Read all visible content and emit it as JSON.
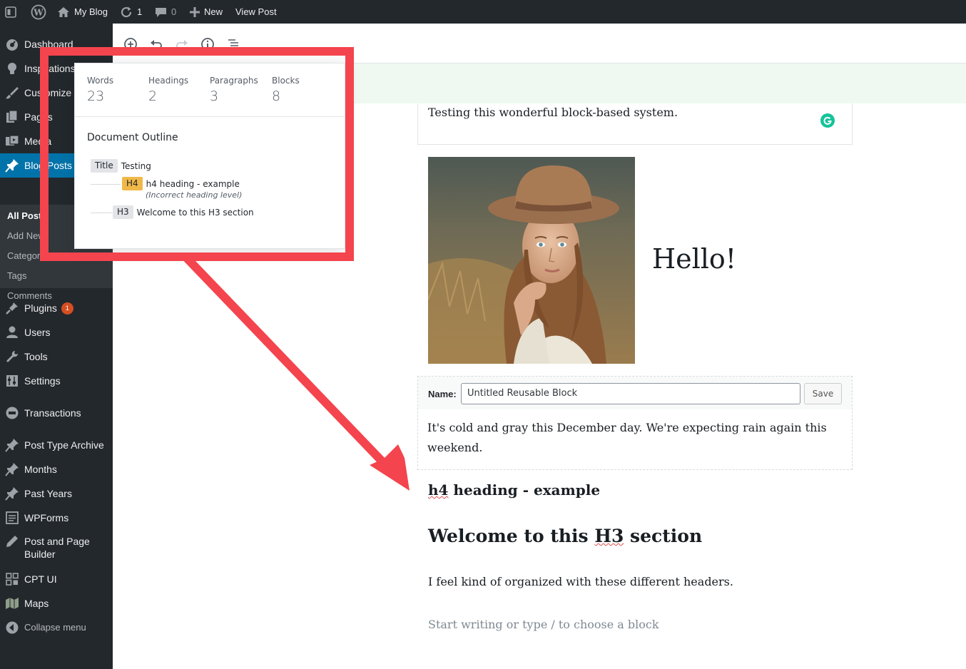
{
  "adminbar": {
    "site_name": "My Blog",
    "updates_count": "1",
    "comments_count": "0",
    "new_label": "New",
    "view_post_label": "View Post"
  },
  "sidebar": {
    "items": [
      {
        "label": "Dashboard",
        "icon": "dashboard-icon"
      },
      {
        "label": "Inspirations",
        "icon": "lightbulb-icon"
      },
      {
        "label": "Customize",
        "icon": "brush-icon"
      },
      {
        "label": "Pages",
        "icon": "pages-icon"
      },
      {
        "label": "Media",
        "icon": "media-icon"
      },
      {
        "label": "Blog Posts",
        "icon": "pin-icon"
      }
    ],
    "submenu": [
      "All Posts",
      "Add New",
      "Categories",
      "Tags",
      "Comments"
    ],
    "items2": [
      {
        "label": "Plugins",
        "icon": "plugin-icon",
        "badge": "1"
      },
      {
        "label": "Users",
        "icon": "user-icon"
      },
      {
        "label": "Tools",
        "icon": "wrench-icon"
      },
      {
        "label": "Settings",
        "icon": "settings-icon"
      },
      {
        "label": "Transactions",
        "icon": "circle-icon"
      },
      {
        "label": "Post Type Archive",
        "icon": "pin-icon"
      },
      {
        "label": "Months",
        "icon": "pin-icon"
      },
      {
        "label": "Past Years",
        "icon": "pin-icon"
      },
      {
        "label": "WPForms",
        "icon": "form-icon"
      },
      {
        "label": "Post and Page Builder",
        "icon": "pencil-icon"
      },
      {
        "label": "CPT UI",
        "icon": "grid-icon"
      },
      {
        "label": "Maps",
        "icon": "map-icon"
      },
      {
        "label": "Collapse menu",
        "icon": "collapse-icon"
      }
    ]
  },
  "info_popover": {
    "counts": [
      {
        "label": "Words",
        "value": "23"
      },
      {
        "label": "Headings",
        "value": "2"
      },
      {
        "label": "Paragraphs",
        "value": "3"
      },
      {
        "label": "Blocks",
        "value": "8"
      }
    ],
    "outline_title": "Document Outline",
    "outline": [
      {
        "tag": "Title",
        "text": "Testing"
      },
      {
        "tag": "H4",
        "text": "h4 heading - example",
        "note": "(Incorrect heading level)"
      },
      {
        "tag": "H3",
        "text": "Welcome to this H3 section"
      }
    ]
  },
  "editor": {
    "para1": "Testing this wonderful block-based system.",
    "hello": "Hello!",
    "reusable_name_label": "Name:",
    "reusable_name_value": "Untitled Reusable Block",
    "reusable_save": "Save",
    "reusable_text": "It's cold and gray this December day.  We're expecting rain again this weekend.",
    "h4_word1": "h4",
    "h4_rest": " heading - example",
    "h3_pre": "Welcome to this ",
    "h3_word": "H3",
    "h3_post": " section",
    "para2": "I feel kind of organized with these different headers.",
    "placeholder": "Start writing or type / to choose a block"
  },
  "colors": {
    "admin_dark": "#23282d",
    "active_blue": "#0073aa",
    "annotation_red": "#f4444d",
    "notice_green": "#eff9f1"
  }
}
